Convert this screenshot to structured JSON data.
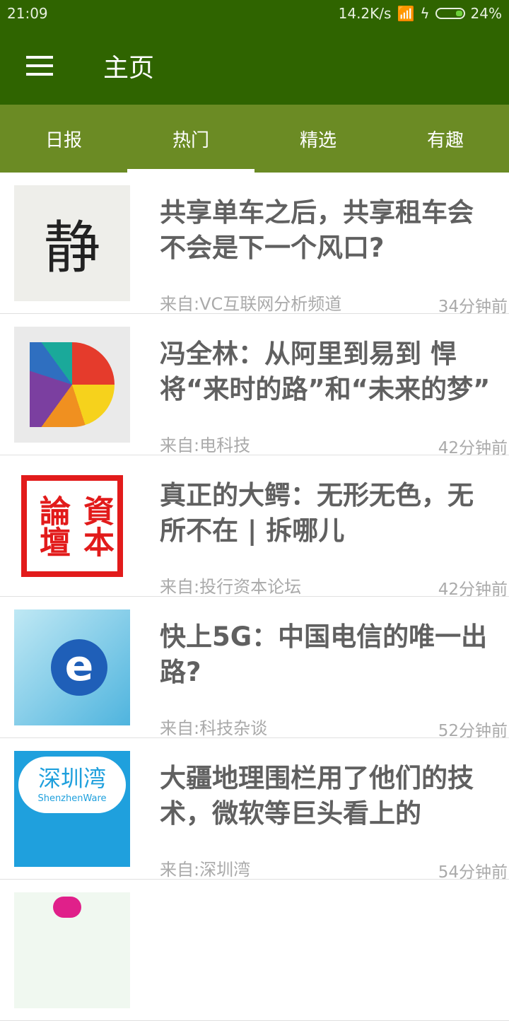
{
  "status": {
    "time": "21:09",
    "speed": "14.2K/s",
    "battery": "24%"
  },
  "toolbar": {
    "title": "主页"
  },
  "tabs": [
    {
      "label": "日报"
    },
    {
      "label": "热门"
    },
    {
      "label": "精选"
    },
    {
      "label": "有趣"
    }
  ],
  "items": [
    {
      "title": "共享单车之后，共享租车会不会是下一个风口?",
      "source": "来自:VC互联网分析频道",
      "time": "34分钟前"
    },
    {
      "title": "冯全林：从阿里到易到 悍将“来时的路”和“未来的梦”",
      "source": "来自:电科技",
      "time": "42分钟前"
    },
    {
      "title": "真正的大鳄：无形无色，无所不在 | 拆哪儿",
      "source": "来自:投行资本论坛",
      "time": "42分钟前"
    },
    {
      "title": "快上5G：中国电信的唯一出路?",
      "source": "来自:科技杂谈",
      "time": "52分钟前"
    },
    {
      "title": "大疆地理围栏用了他们的技术，微软等巨头看上的",
      "source": "来自:深圳湾",
      "time": "54分钟前"
    }
  ],
  "thumbs": {
    "t1": "静",
    "t3a": "資本",
    "t3b": "論壇",
    "t5a": "深圳湾",
    "t5b": "ShenzhenWare"
  }
}
